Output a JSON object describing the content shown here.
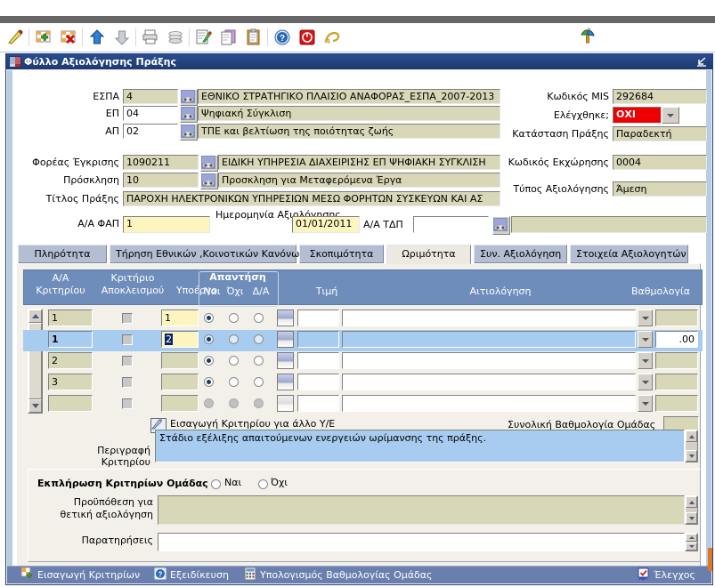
{
  "toolbar": {
    "buttons": [
      {
        "name": "query-pencil-icon",
        "title": "Αναζήτηση"
      },
      {
        "name": "add-row-icon",
        "title": "Εισαγωγή εγγραφής"
      },
      {
        "name": "delete-row-icon",
        "title": "Διαγραφή εγγραφής"
      },
      {
        "name": "arrow-up-icon",
        "title": "Προηγούμενο"
      },
      {
        "name": "arrow-down-icon",
        "title": "Επόμενο"
      },
      {
        "name": "print-icon",
        "title": "Εκτύπωση"
      },
      {
        "name": "stack-icon",
        "title": "Αντιγραφή"
      },
      {
        "name": "edit-note-icon",
        "title": "Επεξεργασία"
      },
      {
        "name": "copy-icon",
        "title": "Αντιγραφή"
      },
      {
        "name": "paste-clipboard-icon",
        "title": "Επικόλληση"
      },
      {
        "name": "help-icon",
        "title": "Βοήθεια"
      },
      {
        "name": "exit-icon",
        "title": "Έξοδος"
      },
      {
        "name": "note-icon",
        "title": "Σημείωση"
      }
    ],
    "tree_icon": "tree-hierarchy-icon"
  },
  "window": {
    "title": "Φύλλο Αξιολόγησης Πράξης",
    "icon": "form-window-icon",
    "restore_icon": "restore-window-icon"
  },
  "header_form": {
    "left": [
      {
        "label": "ΕΣΠΑ",
        "code": "4",
        "desc": "ΕΘΝΙΚΟ ΣΤΡΑΤΗΓΙΚΟ ΠΛΑΙΣΙΟ ΑΝΑΦΟΡΑΣ_ΕΣΠΑ_2007-2013"
      },
      {
        "label": "ΕΠ",
        "code": "04",
        "desc": "Ψηφιακή Σύγκλιση"
      },
      {
        "label": "ΑΠ",
        "code": "02",
        "desc": "ΤΠΕ και βελτίωση της ποιότητας ζωής"
      },
      {
        "label": "Φορέας Έγκρισης",
        "code": "1090211",
        "desc": "ΕΙΔΙΚΗ ΥΠΗΡΕΣΙΑ ΔΙΑΧΕΙΡΙΣΗΣ ΕΠ ΨΗΦΙΑΚΗ ΣΥΓΚΛΙΣΗ"
      },
      {
        "label": "Πρόσκληση",
        "code": "10",
        "desc": "Προσκληση για Μεταφερόμενα Έργα"
      }
    ],
    "title_label": "Τίτλος Πράξης",
    "title_value": "ΠΑΡΟΧΗ ΗΛΕΚΤΡΟΝΙΚΩΝ ΥΠΗΡΕΣΙΩΝ ΜΕΣΩ ΦΟΡΗΤΩΝ ΣΥΣΚΕΥΩΝ ΚΑΙ ΑΣ",
    "right": [
      {
        "label": "Κωδικός MIS",
        "value": "292684"
      },
      {
        "label": "Ελέγχθηκε;",
        "value": "ΟΧΙ"
      },
      {
        "label": "Κατάσταση Πράξης",
        "value": "Παραδεκτή"
      },
      {
        "label": "Κωδικός Εκχώρησης",
        "value": "0004"
      },
      {
        "label": "Τύπος Αξιολόγησης",
        "value": "Άμεση"
      }
    ],
    "aa_fap_label": "Α/Α ΦΑΠ",
    "aa_fap_value": "1",
    "date_label": "Ημερομηνία Αξιολόγησης",
    "date_value": "01/01/2011",
    "aa_tdp_label": "Α/Α ΤΔΠ",
    "aa_tdp_value": "",
    "tdp_desc": ""
  },
  "tabs": [
    {
      "label": "Πληρότητα",
      "active": false
    },
    {
      "label": "Τήρηση Εθνικών ,Κοινοτικών Κανόνων",
      "active": false
    },
    {
      "label": "Σκοπιμότητα",
      "active": false
    },
    {
      "label": "Ωριμότητα",
      "active": true
    },
    {
      "label": "Συν. Αξιολόγηση",
      "active": false
    },
    {
      "label": "Στοιχεία Αξιολογητών",
      "active": false
    }
  ],
  "grid": {
    "headers": {
      "aa_kritiriou": [
        "Α/Α",
        "Κριτηρίου"
      ],
      "kritirio_apokleismou": [
        "Κριτήριο",
        "Αποκλεισμού"
      ],
      "ypoergo": "Υποέργο",
      "apantisi": "Απαντήση",
      "nai": "Ναι",
      "oxi": "Όχι",
      "da": "Δ/Α",
      "timi": "Τιμή",
      "aitiologisi": "Αιτιολόγηση",
      "vathmologia": "Βαθμολογία"
    },
    "rows": [
      {
        "aa": "1",
        "excl": false,
        "ypoergo": "1",
        "answer": "nai",
        "timi": "",
        "aitiologisi": "",
        "vathmologia": "",
        "selected": false,
        "enabled": true
      },
      {
        "aa": "1",
        "excl": false,
        "ypoergo": "2",
        "answer": "nai",
        "timi": "",
        "aitiologisi": "",
        "vathmologia": ".00",
        "selected": true,
        "enabled": true
      },
      {
        "aa": "2",
        "excl": false,
        "ypoergo": "",
        "answer": "nai",
        "timi": "",
        "aitiologisi": "",
        "vathmologia": "",
        "selected": false,
        "enabled": true
      },
      {
        "aa": "3",
        "excl": false,
        "ypoergo": "",
        "answer": "nai",
        "timi": "",
        "aitiologisi": "",
        "vathmologia": "",
        "selected": false,
        "enabled": true
      },
      {
        "aa": "",
        "excl": false,
        "ypoergo": "",
        "answer": "none",
        "timi": "",
        "aitiologisi": "",
        "vathmologia": "",
        "selected": false,
        "enabled": false
      }
    ]
  },
  "mid": {
    "insert_criterion_label": "Εισαγωγή Κριτηρίου για άλλο Υ/Ε",
    "insert_criterion_icon": "insert-criterion-icon",
    "total_group_score_label": "Συνολική Βαθμολογία Ομάδας",
    "total_group_score_value": "",
    "criterion_desc_label": "Περιγραφή Κριτηρίου",
    "criterion_desc_value": "Στάδιο εξέλιξης απαιτούμενων ενεργειών ωρίμανσης της πράξης."
  },
  "group_fulfilment": {
    "title": "Εκπλήρωση Κριτηρίων Ομάδας",
    "yes_label": "Ναι",
    "no_label": "Όχι",
    "selected": "",
    "precondition_label": [
      "Προϋπόθεση για",
      "θετική αξιολόγηση"
    ],
    "precondition_value": "",
    "remarks_label": "Παρατηρήσεις",
    "remarks_value": ""
  },
  "statusbar": {
    "items": [
      {
        "name": "insert-criteria-button",
        "label": "Εισαγωγή Κριτηρίων",
        "icon": "grid-plus-icon"
      },
      {
        "name": "specialization-button",
        "label": "Εξειδίκευση",
        "icon": "question-icon"
      },
      {
        "name": "calc-group-score-button",
        "label": "Υπολογισμός Βαθμολογίας Ομάδας",
        "icon": "calculator-icon"
      }
    ],
    "right_item": {
      "name": "validate-button",
      "label": "Έλεγχος",
      "icon": "check-rosette-icon"
    }
  },
  "colors": {
    "title_bar": "#1d3a70",
    "accent_blue": "#6f8dbb",
    "field_beige": "#d8d7b8",
    "field_yellow": "#fdf5bf",
    "selection_blue": "#a8ccf0",
    "alert_red": "#ee0000",
    "status_bar": "#6b7fae"
  }
}
